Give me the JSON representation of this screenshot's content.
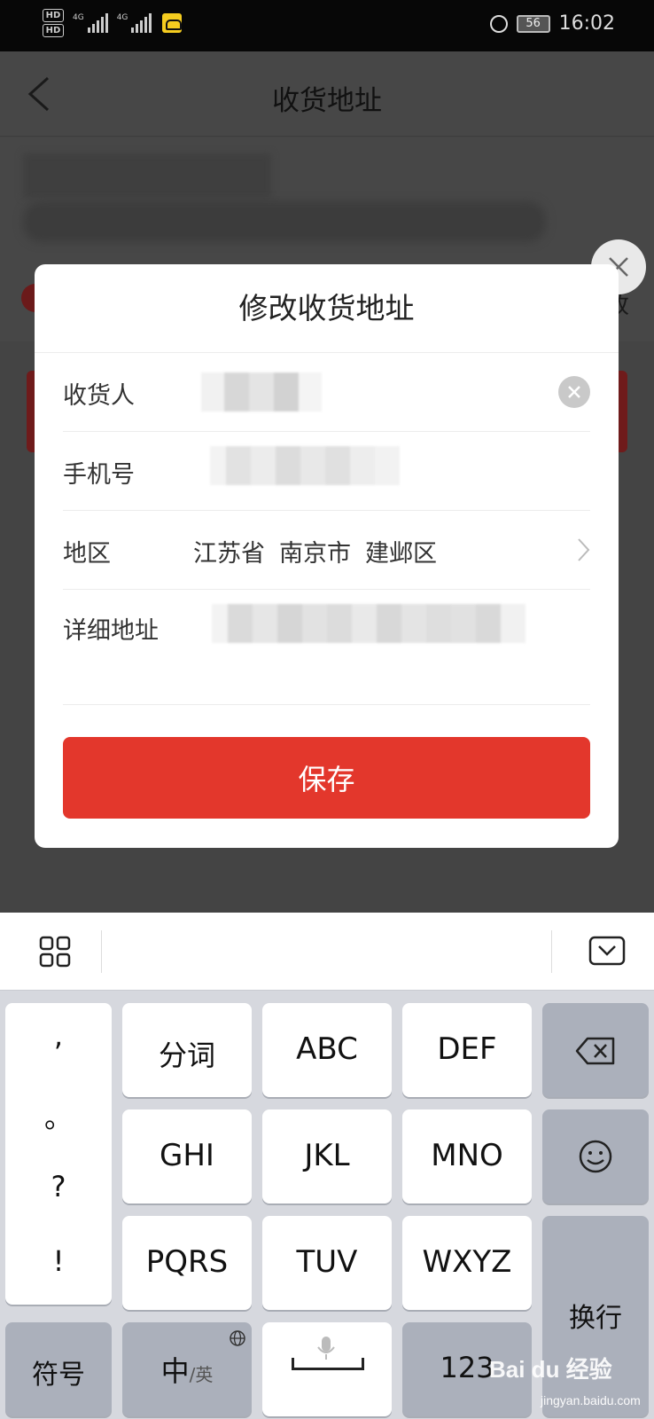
{
  "status_bar": {
    "hd1": "HD",
    "hd2": "HD",
    "net1": "4G",
    "net2": "4G",
    "battery": "56",
    "time": "16:02"
  },
  "page": {
    "title": "收货地址",
    "partial_right_text": "改"
  },
  "dialog": {
    "title": "修改收货地址",
    "fields": {
      "recipient_label": "收货人",
      "phone_label": "手机号",
      "region_label": "地区",
      "region_province": "江苏省",
      "region_city": "南京市",
      "region_district": "建邺区",
      "detail_label": "详细地址"
    },
    "save_label": "保存"
  },
  "keyboard": {
    "punct": [
      ",",
      "。",
      "?",
      "!"
    ],
    "keys": {
      "fenci": "分词",
      "abc": "ABC",
      "def": "DEF",
      "ghi": "GHI",
      "jkl": "JKL",
      "mno": "MNO",
      "pqrs": "PQRS",
      "tuv": "TUV",
      "wxyz": "WXYZ",
      "symbols": "符号",
      "lang_main": "中",
      "lang_sub": "/英",
      "numbers": "123",
      "enter": "换行"
    }
  },
  "watermark": {
    "text": "Bai du 经验",
    "url": "jingyan.baidu.com"
  }
}
